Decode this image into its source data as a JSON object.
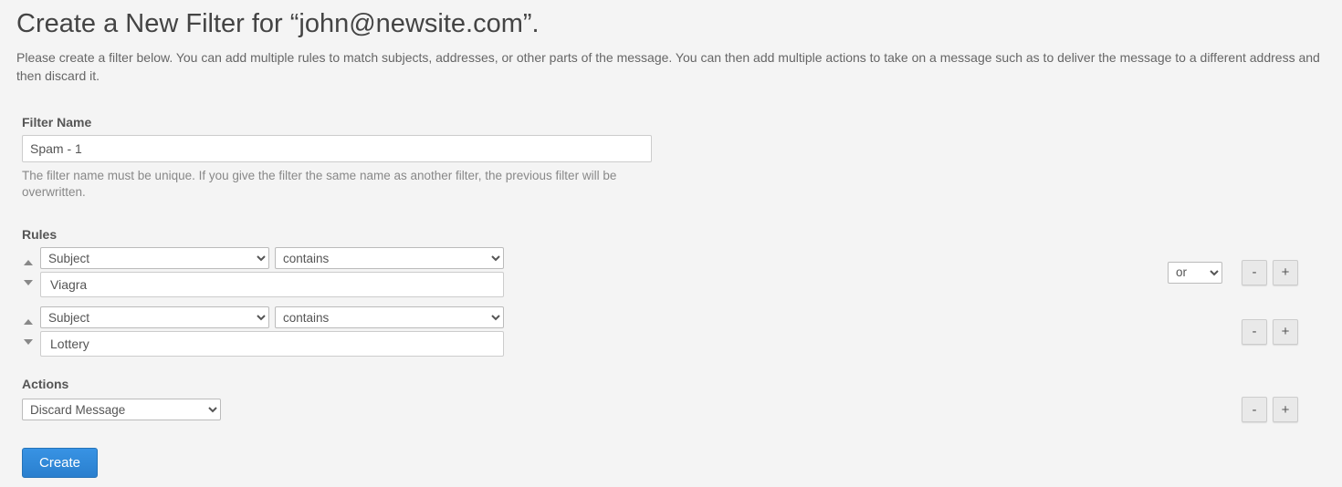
{
  "page": {
    "title": "Create a New Filter for “john@newsite.com”.",
    "intro": "Please create a filter below. You can add multiple rules to match subjects, addresses, or other parts of the message. You can then add multiple actions to take on a message such as to deliver the message to a different address and then discard it."
  },
  "filter_name": {
    "label": "Filter Name",
    "value": "Spam - 1",
    "hint": "The filter name must be unique. If you give the filter the same name as another filter, the previous filter will be overwritten."
  },
  "rules": {
    "label": "Rules",
    "join_selected": "or",
    "items": [
      {
        "field": "Subject",
        "operator": "contains",
        "value": "Viagra",
        "show_join": true
      },
      {
        "field": "Subject",
        "operator": "contains",
        "value": "Lottery",
        "show_join": false
      }
    ]
  },
  "actions": {
    "label": "Actions",
    "items": [
      {
        "action": "Discard Message"
      }
    ]
  },
  "buttons": {
    "create": "Create",
    "minus": "-",
    "plus": "+"
  }
}
